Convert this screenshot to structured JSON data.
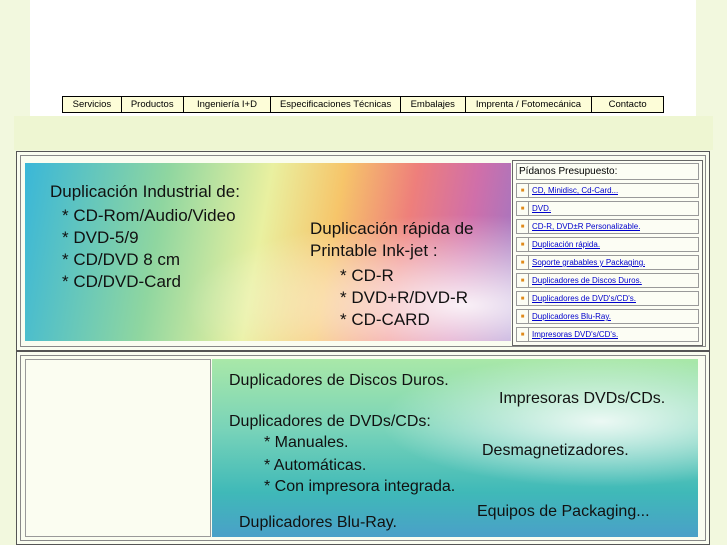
{
  "nav": {
    "items": [
      "Servicios",
      "Productos",
      "Ingeniería  I+D",
      "Especificaciones Técnicas",
      "Embalajes",
      "Imprenta / Fotomecánica",
      "Contacto"
    ]
  },
  "banner1": {
    "heading": "Duplicación Industrial de:",
    "items": [
      "* CD-Rom/Audio/Video",
      "* DVD-5/9",
      "* CD/DVD 8 cm",
      "* CD/DVD-Card"
    ],
    "heading2_line1": "Duplicación rápida de",
    "heading2_line2": "Printable Ink-jet :",
    "items2": [
      "* CD-R",
      "* DVD+R/DVD-R",
      "* CD-CARD"
    ]
  },
  "sidebar": {
    "title": "Pídanos Presupuesto:",
    "links": [
      "CD, Minidisc, Cd-Card...",
      "DVD.",
      "CD-R, DVD±R Personalizable.",
      "Duplicación rápida.",
      "Soporte grabables y Packaging.",
      "Duplicadores de Discos Duros.",
      "Duplicadores de DVD's/CD's.",
      "Duplicadores Blu-Ray.",
      "Impresoras DVD's/CD's."
    ]
  },
  "banner2": {
    "line1": "Duplicadores de Discos Duros.",
    "line2": "Impresoras DVDs/CDs.",
    "line3": "Duplicadores de DVDs/CDs:",
    "line4": "* Manuales.",
    "line5": "Desmagnetizadores.",
    "line6": "* Automáticas.",
    "line7": "* Con impresora integrada.",
    "line8": "Equipos de Packaging...",
    "line9": "Duplicadores Blu-Ray."
  },
  "colors": {
    "nav_bg": "#fdfdd8",
    "link": "#0000cc",
    "bullet": "#e08a1a"
  }
}
